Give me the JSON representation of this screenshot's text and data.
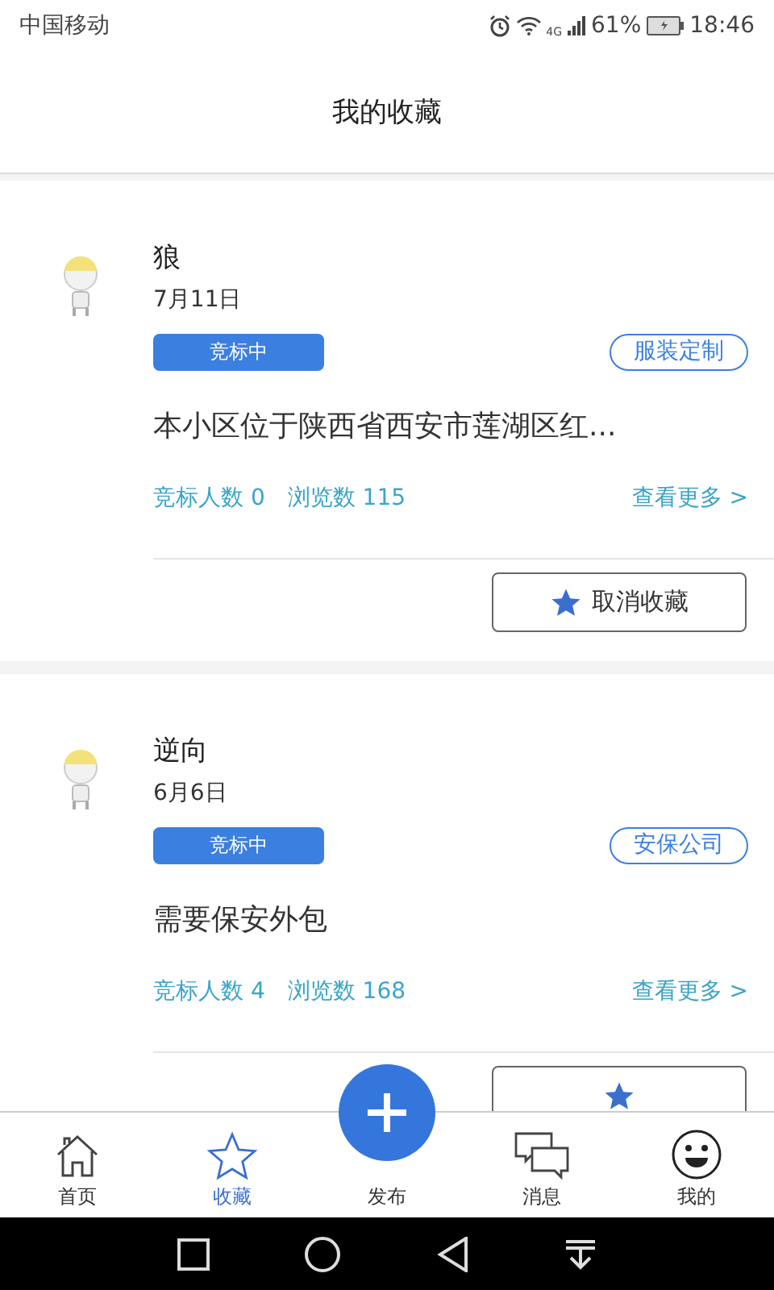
{
  "status_bar": {
    "carrier": "中国移动",
    "network": "4G",
    "battery": "61%",
    "time": "18:46"
  },
  "header": {
    "title": "我的收藏"
  },
  "cards": [
    {
      "name": "狼",
      "date": "7月11日",
      "status": "竞标中",
      "category": "服装定制",
      "description": "本小区位于陕西省西安市莲湖区红...",
      "bidders": "竞标人数 0",
      "views": "浏览数 115",
      "more": "查看更多 >",
      "button_label": "取消收藏"
    },
    {
      "name": "逆向",
      "date": "6月6日",
      "status": "竞标中",
      "category": "安保公司",
      "description": "需要保安外包",
      "bidders": "竞标人数 4",
      "views": "浏览数 168",
      "more": "查看更多 >"
    }
  ],
  "tabs": [
    {
      "kind": "home",
      "label": "首页",
      "selected": false
    },
    {
      "kind": "star",
      "label": "收藏",
      "selected": true
    },
    {
      "kind": "add",
      "label": "发布",
      "selected": false
    },
    {
      "kind": "chat",
      "label": "消息",
      "selected": false
    },
    {
      "kind": "face",
      "label": "我的",
      "selected": false
    }
  ]
}
